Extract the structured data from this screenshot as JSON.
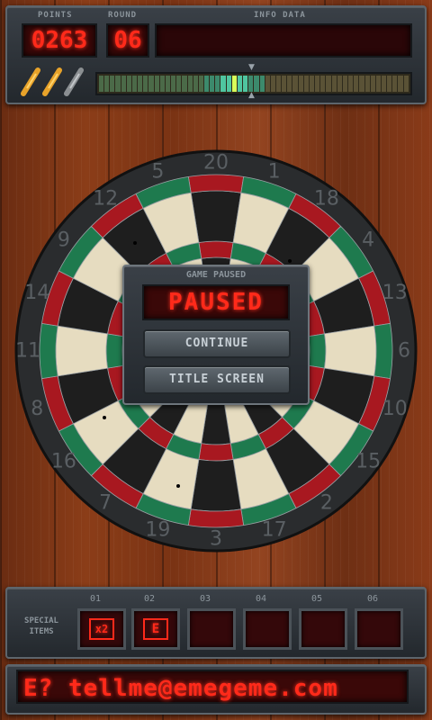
{
  "hud": {
    "points_label": "POINTS",
    "points_value": "0263",
    "round_label": "ROUND",
    "round_value": "06",
    "info_label": "INFO DATA",
    "info_value": ""
  },
  "darts_remaining": 2,
  "power_meter_level": 0.42,
  "board": {
    "numbers": [
      "20",
      "1",
      "18",
      "4",
      "13",
      "6",
      "10",
      "15",
      "2",
      "17",
      "3",
      "19",
      "7",
      "16",
      "8",
      "11",
      "14",
      "9",
      "12",
      "5"
    ]
  },
  "pause_dialog": {
    "header": "GAME PAUSED",
    "status": "PAUSED",
    "continue_label": "CONTINUE",
    "title_screen_label": "TITLE SCREEN"
  },
  "special_items": {
    "label_line1": "SPECIAL",
    "label_line2": "ITEMS",
    "slots": [
      {
        "label": "01",
        "glyph": "x2"
      },
      {
        "label": "02",
        "glyph": "E"
      },
      {
        "label": "03",
        "glyph": ""
      },
      {
        "label": "04",
        "glyph": ""
      },
      {
        "label": "05",
        "glyph": ""
      },
      {
        "label": "06",
        "glyph": ""
      }
    ]
  },
  "ticker": {
    "text": "E? tellme@emegeme.com"
  },
  "colors": {
    "led_red": "#ff2a1a",
    "board_red": "#a81820",
    "board_green": "#1e7a4e",
    "board_cream": "#e6dcc0",
    "board_black": "#1e1e1e"
  }
}
